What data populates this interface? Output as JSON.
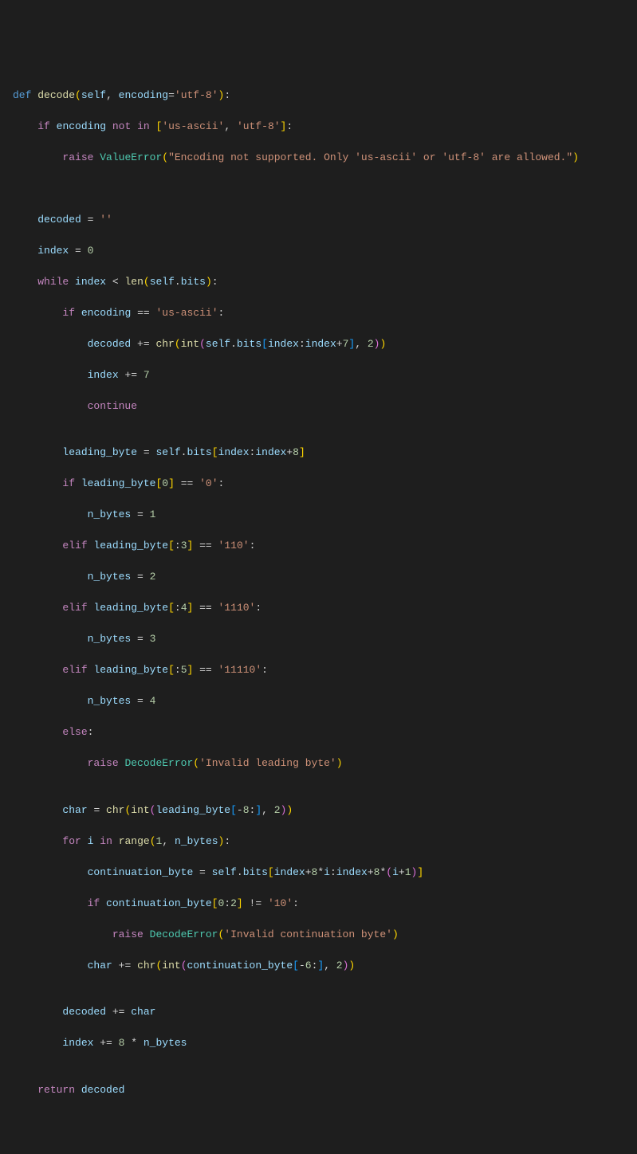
{
  "code": {
    "l1": {
      "def": "def",
      "fn": "decode",
      "self": "self",
      "enc": "encoding",
      "defval": "'utf-8'"
    },
    "l2": {
      "if": "if",
      "enc": "encoding",
      "notin": "not in",
      "list": "['us-ascii', 'utf-8']"
    },
    "l3": {
      "raise": "raise",
      "err": "ValueError",
      "msg": "\"Encoding not supported. Only 'us-ascii' or 'utf-8' are allowed.\""
    },
    "l6": {
      "var": "decoded",
      "val": "''"
    },
    "l7": {
      "var": "index",
      "val": "0"
    },
    "l8": {
      "while": "while",
      "idx": "index",
      "lt": "<",
      "len": "len",
      "self": "self",
      "bits": "bits"
    },
    "l9": {
      "if": "if",
      "enc": "encoding",
      "eq": "==",
      "val": "'us-ascii'"
    },
    "l10": {
      "dec": "decoded",
      "chr": "chr",
      "int": "int",
      "self": "self",
      "bits": "bits",
      "idx1": "index",
      "idx2": "index",
      "plus": "7",
      "base": "2"
    },
    "l11": {
      "idx": "index",
      "val": "7"
    },
    "l12": {
      "cont": "continue"
    },
    "l14": {
      "lb": "leading_byte",
      "self": "self",
      "bits": "bits",
      "idx1": "index",
      "idx2": "index",
      "plus": "8"
    },
    "l15": {
      "if": "if",
      "lb": "leading_byte",
      "sub": "0",
      "eq": "==",
      "val": "'0'"
    },
    "l16": {
      "nb": "n_bytes",
      "val": "1"
    },
    "l17": {
      "elif": "elif",
      "lb": "leading_byte",
      "sub": ":3",
      "eq": "==",
      "val": "'110'"
    },
    "l18": {
      "nb": "n_bytes",
      "val": "2"
    },
    "l19": {
      "elif": "elif",
      "lb": "leading_byte",
      "sub": ":4",
      "eq": "==",
      "val": "'1110'"
    },
    "l20": {
      "nb": "n_bytes",
      "val": "3"
    },
    "l21": {
      "elif": "elif",
      "lb": "leading_byte",
      "sub": ":5",
      "eq": "==",
      "val": "'11110'"
    },
    "l22": {
      "nb": "n_bytes",
      "val": "4"
    },
    "l23": {
      "else": "else"
    },
    "l24": {
      "raise": "raise",
      "err": "DecodeError",
      "msg": "'Invalid leading byte'"
    },
    "l26": {
      "char": "char",
      "chr": "chr",
      "int": "int",
      "lb": "leading_byte",
      "slice": "-8:",
      "base": "2"
    },
    "l27": {
      "for": "for",
      "i": "i",
      "in": "in",
      "range": "range",
      "a": "1",
      "nb": "n_bytes"
    },
    "l28": {
      "cb": "continuation_byte",
      "self": "self",
      "bits": "bits",
      "idx": "index",
      "eight": "8",
      "i": "i",
      "idx2": "index",
      "eight2": "8",
      "i2": "i",
      "one": "1"
    },
    "l29": {
      "if": "if",
      "cb": "continuation_byte",
      "slice": "0:2",
      "ne": "!=",
      "val": "'10'"
    },
    "l30": {
      "raise": "raise",
      "err": "DecodeError",
      "msg": "'Invalid continuation byte'"
    },
    "l31": {
      "char": "char",
      "chr": "chr",
      "int": "int",
      "cb": "continuation_byte",
      "slice": "-6:",
      "base": "2"
    },
    "l33": {
      "dec": "decoded",
      "char": "char"
    },
    "l34": {
      "idx": "index",
      "eight": "8",
      "nb": "n_bytes"
    },
    "l36": {
      "ret": "return",
      "dec": "decoded"
    }
  }
}
